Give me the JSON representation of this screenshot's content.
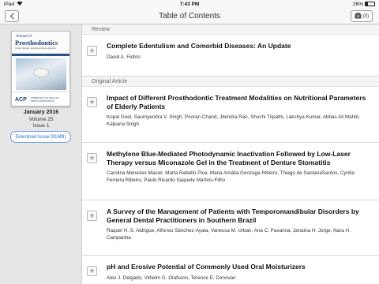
{
  "status_bar": {
    "carrier": "iPad",
    "time": "7:43 PM",
    "battery_text": "26%",
    "battery_level": 0.26
  },
  "nav_bar": {
    "title": "Table of Contents",
    "back_icon": "chevron-left-icon",
    "cart_icon": "download-bin-icon",
    "cart_count": "(0)"
  },
  "issue": {
    "cover": {
      "journal_of": "Journal of",
      "journal_name": "Prosthodontics",
      "subtitle": "Implant, Esthetic, and Reconstructive Dentistry",
      "acp": "ACP",
      "publisher": "AMERICAN COLLEGE OF PROSTHODONTISTS"
    },
    "date": "January 2016",
    "volume": "Volume 25",
    "number": "Issue 1",
    "download_label": "Download Issue (91MB)"
  },
  "sections": [
    {
      "name": "Review",
      "articles": [
        {
          "title": "Complete Edentulism and Comorbid Diseases: An Update",
          "authors": "David A. Felton"
        }
      ]
    },
    {
      "name": "Original Article",
      "articles": [
        {
          "title": "Impact of Different Prosthodontic Treatment Modalities on Nutritional Parameters of Elderly Patients",
          "authors": "Kopal Goel, Saumyendra V. Singh, Pooran Chand, Jitendra Rao, Shuchi Tripathi, Lakshya Kumar, Abbas Ali Mahdi, Kalpana Singh"
        },
        {
          "title": "Methylene Blue-Mediated Photodynamic Inactivation Followed by Low-Laser Therapy versus Miconazole Gel in the Treatment of Denture Stomatitis",
          "authors": "Carolina Menezes Maciel, Marta Rabello Piva, Maria Amália Gonzaga Ribeiro, Thiago de SantanaSantos, Cyntia Ferreira Ribeiro, Paulo Ricardo Saquete Martins-Filho"
        },
        {
          "title": "A Survey of the Management of Patients with Temporomandibular Disorders by General Dental Practitioners in Southern Brazil",
          "authors": "Raquel H. S. Aldrigue, Alfonso Sánchez-Ayala, Vanessa M. Urban, Ana C. Pavarina, Janaina H. Jorge, Nara H. Campanha"
        },
        {
          "title": "pH and Erosive Potential of Commonly Used Oral Moisturizers",
          "authors": "Alex J. Delgado, Vilhelm G. Olafsson, Terence E. Donovan"
        }
      ]
    }
  ],
  "colors": {
    "accent": "#2e6fcf",
    "bar_background": "#f7f7f7",
    "sidebar_background": "#e6e6e6"
  }
}
